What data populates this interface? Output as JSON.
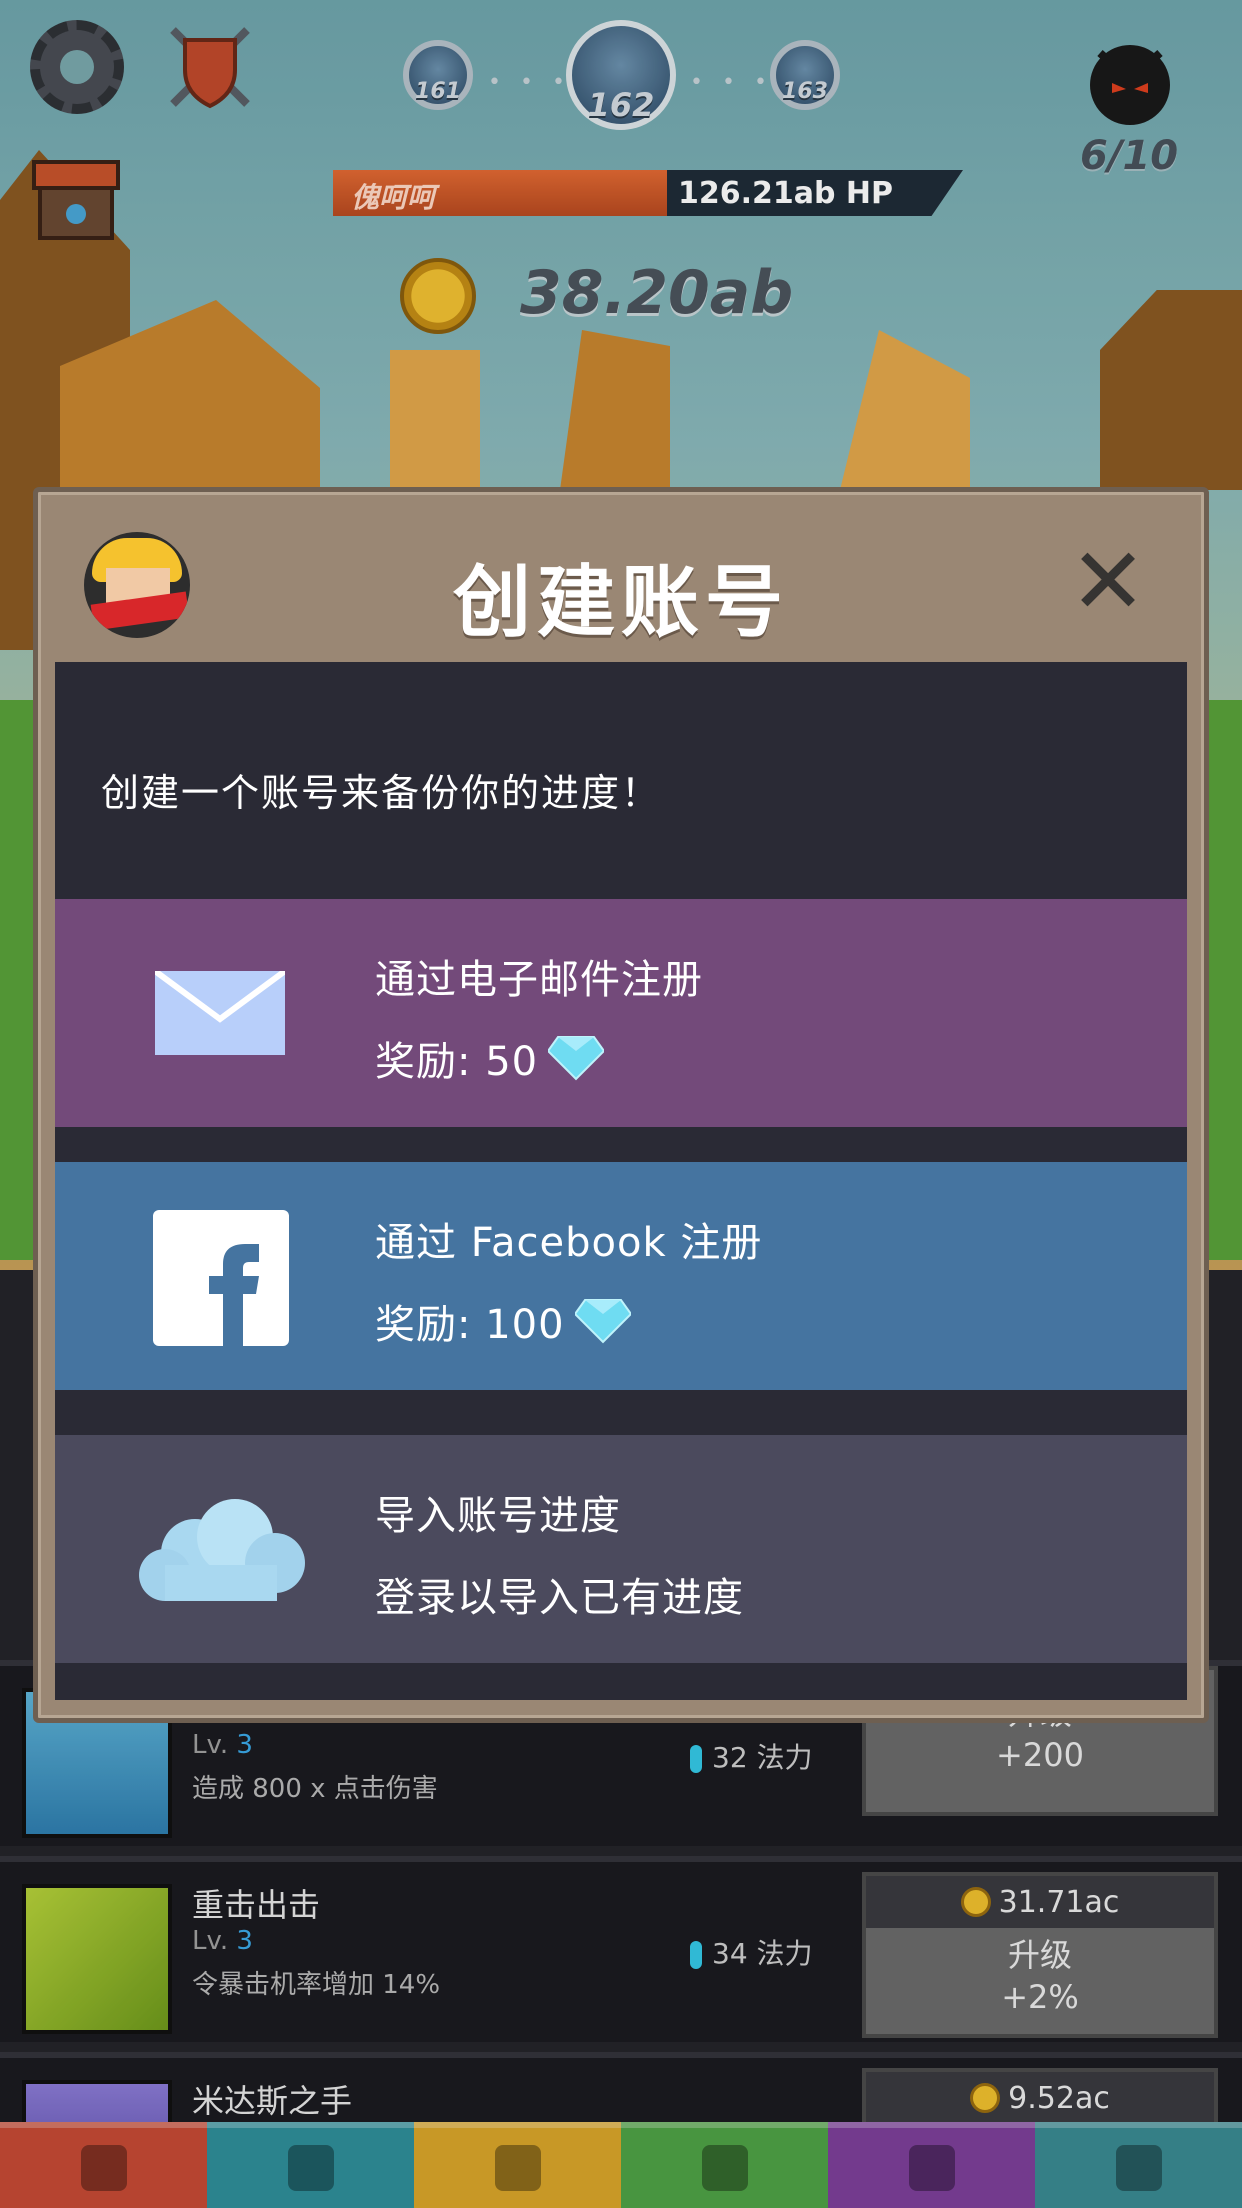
{
  "hud": {
    "stage_prev": "161",
    "stage_current": "162",
    "stage_next": "163",
    "boss_counter": "6/10",
    "enemy_name": "傀呵呵",
    "enemy_hp": "126.21ab HP",
    "gold": "38.20ab"
  },
  "modal": {
    "title": "创建账号",
    "intro": "创建一个账号来备份你的进度！",
    "email_option": {
      "title": "通过电子邮件注册",
      "reward_label": "奖励: 50"
    },
    "facebook_option": {
      "title": "通过 Facebook 注册",
      "reward_label": "奖励: 100"
    },
    "import_option": {
      "title": "导入账号进度",
      "subtitle": "登录以导入已有进度"
    }
  },
  "skills": [
    {
      "name": "",
      "level_prefix": "Lv.",
      "level": "3",
      "desc": "造成 800 x 点击伤害",
      "mana": "32 法力",
      "cost": "",
      "upgrade": "升级",
      "upgrade_amount": "+200"
    },
    {
      "name": "重击出击",
      "level_prefix": "Lv.",
      "level": "3",
      "desc": "令暴击机率增加 14%",
      "mana": "34 法力",
      "cost": "31.71ac",
      "upgrade": "升级",
      "upgrade_amount": "+2%"
    },
    {
      "name": "米达斯之手",
      "level_prefix": "",
      "level": "",
      "desc": "",
      "mana": "",
      "cost": "9.52ac",
      "upgrade": "",
      "upgrade_amount": ""
    }
  ],
  "colors": {
    "email_bg": "#734a7a",
    "facebook_bg": "#4574a0",
    "import_bg": "#4b4a5d",
    "modal_frame": "#9a8774",
    "tab_colors": [
      "#c64a35",
      "#2f8f9a",
      "#d9a52a",
      "#4fa246",
      "#7d3f9a",
      "#3a8a92"
    ]
  },
  "icons": {
    "settings": "gear-icon",
    "clan": "shield-icon",
    "shop": "shop-icon",
    "boss": "demon-icon",
    "gold": "coin-icon",
    "email": "envelope-icon",
    "facebook": "facebook-icon",
    "import": "cloud-icon",
    "gem": "diamond-icon",
    "close": "close-icon"
  }
}
